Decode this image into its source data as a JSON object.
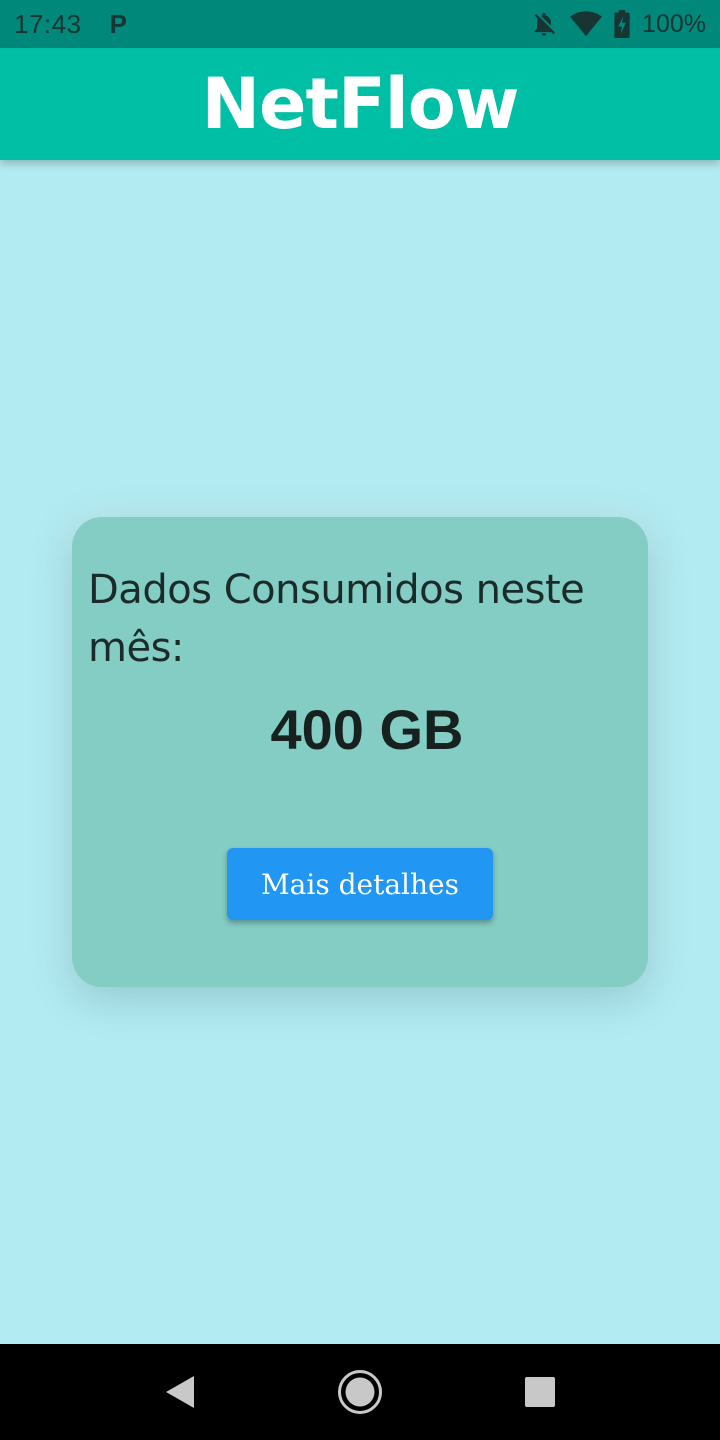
{
  "status_bar": {
    "time": "17:43",
    "notification_glyph": "P",
    "battery": "100%",
    "icons": [
      "notifications-off-icon",
      "wifi-icon",
      "battery-charging-icon"
    ]
  },
  "app_bar": {
    "title": "NetFlow"
  },
  "card": {
    "label": "Dados Consumidos neste mês:",
    "value": "400 GB",
    "button_label": "Mais detalhes"
  },
  "nav_bar": {
    "icons": [
      "back-icon",
      "home-icon",
      "recents-icon"
    ]
  },
  "colors": {
    "status_bar": "#00897b",
    "app_bar": "#00bfa5",
    "background": "#b3ebf2",
    "card": "#83cdc5",
    "button": "#2196f3"
  }
}
